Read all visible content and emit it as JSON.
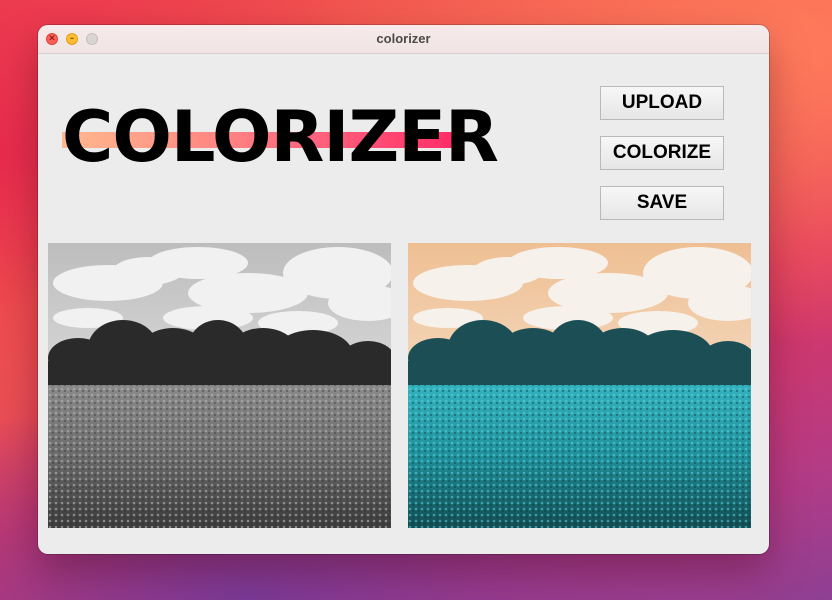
{
  "window": {
    "title": "colorizer",
    "controls": {
      "close_icon": "close-icon",
      "minimize_icon": "minimize-icon",
      "zoom_icon": "zoom-icon"
    }
  },
  "logo": {
    "text": "COLORIZER",
    "underline_colors": [
      "#ffb98e",
      "#ff8c84",
      "#ff5a7a",
      "#ff2a66"
    ]
  },
  "buttons": {
    "upload": "UPLOAD",
    "colorize": "COLORIZE",
    "save": "SAVE"
  },
  "images": {
    "original": {
      "description_icon": "grayscale-landscape-image",
      "palette": [
        "#cfcfcf",
        "#555555",
        "#7a7a7a"
      ]
    },
    "colorized": {
      "description_icon": "colorized-landscape-image",
      "palette": [
        "#f1c49a",
        "#1e5a5f",
        "#2fa8b3"
      ]
    }
  }
}
